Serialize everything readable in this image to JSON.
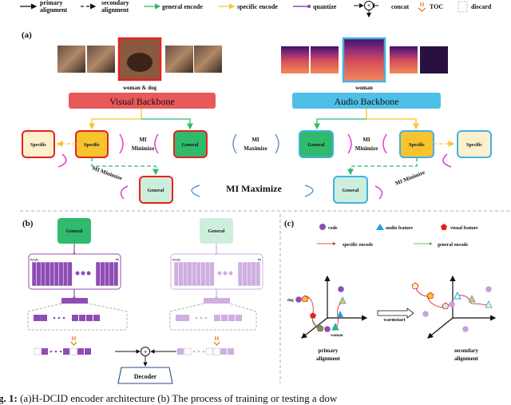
{
  "legend": {
    "primary_alignment": [
      "primary",
      "alignment"
    ],
    "secondary_alignment": [
      "secondary",
      "alignment"
    ],
    "general_encode": "general encode",
    "specific_encode": "specific encode",
    "quantize": "quantize",
    "concat": "concat",
    "toc": "TOC",
    "discard": "discard"
  },
  "colors": {
    "red": "#e8201c",
    "blue": "#3fb2e6",
    "green": "#2fba6e",
    "light_green": "#cdeedd",
    "yellow": "#f7c430",
    "light_yellow": "#fdf0cc",
    "purple": "#8e4cb5",
    "light_purple": "#cfaee0",
    "magenta": "#e040c8",
    "orange": "#ef7a22",
    "visual_backbone": "#e8595a",
    "audio_backbone": "#4ebfe6"
  },
  "panel_a": {
    "label": "(a)",
    "visual_caption": "woman & dog",
    "audio_caption": "woman",
    "visual_backbone": "Visual Backbone",
    "audio_backbone": "Audio Backbone",
    "specific": "Specific",
    "general": "General",
    "mi_minimize": [
      "MI",
      "Minimize"
    ],
    "mi_maximize_small": [
      "MI",
      "Maximize"
    ],
    "mi_minimize_diag": "MI Minimize",
    "mi_maximize": "MI Maximize"
  },
  "panel_b": {
    "label": "(b)",
    "general": "General",
    "codebook_labels": [
      "e₁e₂e₃",
      "eₖ"
    ],
    "decoder": "Decoder"
  },
  "panel_c": {
    "label": "(c)",
    "legend_code": "code",
    "legend_audio": "audio feature",
    "legend_visual": "visual feature",
    "legend_specific": "specific encode",
    "legend_general": "general encode",
    "dog": "dog",
    "woman": "woman",
    "warmstart": "warmstart",
    "primary": [
      "primary",
      "alignment"
    ],
    "secondary": [
      "secondary",
      "alignment"
    ]
  },
  "caption": {
    "prefix": "g. 1:",
    "text": " (a)H-DCID encoder architecture (b) The process of training or testing a dow"
  }
}
